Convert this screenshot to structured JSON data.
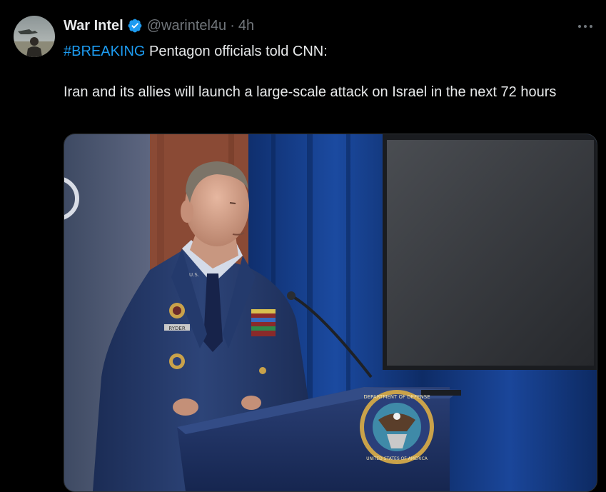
{
  "tweet": {
    "author": {
      "display_name": "War Intel",
      "handle": "@warintel4u",
      "verified": true
    },
    "separator": "·",
    "timestamp": "4h",
    "hashtag": "#BREAKING",
    "headline_rest": " Pentagon officials told CNN:",
    "body": "Iran and its allies will launch a large-scale attack on Israel in the next 72 hours",
    "more_icon": "more-horizontal-icon"
  },
  "media": {
    "seal_text_top": "DEPARTMENT OF DEFENSE",
    "seal_text_bottom": "UNITED STATES OF AMERICA",
    "nameplate_text": "RYDER",
    "badge_text": "U.S."
  },
  "colors": {
    "background": "#000000",
    "text_primary": "#e7e9ea",
    "text_secondary": "#71767b",
    "accent": "#1d9bf0"
  }
}
